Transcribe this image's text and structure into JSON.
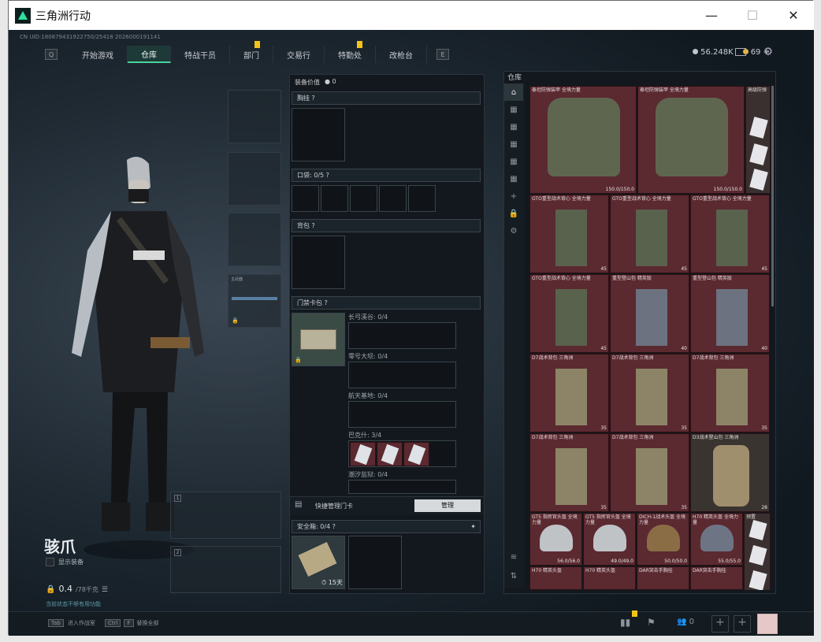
{
  "window": {
    "title": "三角洲行动",
    "minimize": "—",
    "maximize": "☐",
    "close": "✕"
  },
  "session_id": "CN UID:180879431922750/25418 2026000191141",
  "nav": {
    "prev_key": "Q",
    "next_key": "E",
    "tabs": [
      {
        "label": "开始游戏"
      },
      {
        "label": "仓库"
      },
      {
        "label": "特战干员"
      },
      {
        "label": "部门"
      },
      {
        "label": "交易行"
      },
      {
        "label": "特勤处"
      },
      {
        "label": "改枪台"
      }
    ]
  },
  "currency": {
    "hafcoin": "56.248K",
    "coupons": "69",
    "coupons_add": "+"
  },
  "operator": {
    "name": "骇爪",
    "show_equipment": "显示装备",
    "weight_current": "0.4",
    "weight_max": "/78千克",
    "hint": "当前状态不够有用功能",
    "primary_weapon_label": "主武器"
  },
  "equipment": {
    "value_label": "装备价值",
    "value": "0",
    "chest_rig_label": "胸挂",
    "pockets_label": "口袋:",
    "pockets_count": "0/5",
    "backpack_label": "背包",
    "keycard_pack_label": "门禁卡包",
    "keycard_maps": [
      {
        "name": "长弓溪谷:",
        "count": "0/4"
      },
      {
        "name": "零号大坝:",
        "count": "0/4"
      },
      {
        "name": "航天基地:",
        "count": "0/4"
      },
      {
        "name": "巴克什:",
        "count": "3/4"
      },
      {
        "name": "潮汐监狱:",
        "count": "0/4"
      }
    ],
    "quick_manage_label": "快捷管理门卡",
    "manage_button": "管理",
    "safe_box_label": "安全箱:",
    "safe_box_count": "0/4",
    "safe_box_days": "15天"
  },
  "warehouse": {
    "title": "仓库",
    "items": [
      {
        "tag": "泰坦防弹装甲 全境力量",
        "value": "150.0/150.0"
      },
      {
        "tag": "泰坦防弹装甲 全境力量",
        "value": "150.0/150.0"
      },
      {
        "tag": "GTO重型战术背心 全境力量",
        "value": "45"
      },
      {
        "tag": "GTO重型战术背心 全境力量",
        "value": "45"
      },
      {
        "tag": "GTO重型战术背心 全境力量",
        "value": "45"
      },
      {
        "tag": "GTO重型战术背心 全境力量",
        "value": "45"
      },
      {
        "tag": "重型登山包 精英版",
        "value": "40"
      },
      {
        "tag": "重型登山包 精英版",
        "value": "40"
      },
      {
        "tag": "D7战术背包 三角洲",
        "value": "35"
      },
      {
        "tag": "D7战术背包 三角洲",
        "value": "35"
      },
      {
        "tag": "D7战术背包 三角洲",
        "value": "35"
      },
      {
        "tag": "D7战术背包 三角洲",
        "value": "35"
      },
      {
        "tag": "D7战术背包 三角洲",
        "value": "35"
      },
      {
        "tag": "D3战术登山包 三角洲",
        "value": "28"
      },
      {
        "tag": "GT5 指挥官头盔 全境力量",
        "value": "56.0/56.0"
      },
      {
        "tag": "GT5 指挥官头盔 全境力量",
        "value": "49.0/49.0"
      },
      {
        "tag": "DICH-1战术头盔 全境力量",
        "value": "50.0/50.0"
      },
      {
        "tag": "H70 精英头盔 全境力量",
        "value": "55.0/55.0"
      },
      {
        "tag": "H70 精英头盔",
        "value": ""
      },
      {
        "tag": "H70 精英头盔",
        "value": ""
      },
      {
        "tag": "DAR突击手胸挂",
        "value": ""
      },
      {
        "tag": "DAR突击手胸挂",
        "value": ""
      }
    ],
    "side_column_tags": [
      "高级防弹",
      "(防)",
      "(防)",
      "(防)",
      "预置",
      "预置",
      "预置"
    ]
  },
  "bottom": {
    "tab_key": "Tab",
    "tab_label": "进入作战室",
    "ctrl_key": "Ctrl",
    "ctrl_key2": "F",
    "ctrl_label": "替换全部",
    "friends_count": "0"
  },
  "colors": {
    "accent": "#4ad49c",
    "warehouse_cell": "#5b2930",
    "notice": "#f5c21a"
  }
}
